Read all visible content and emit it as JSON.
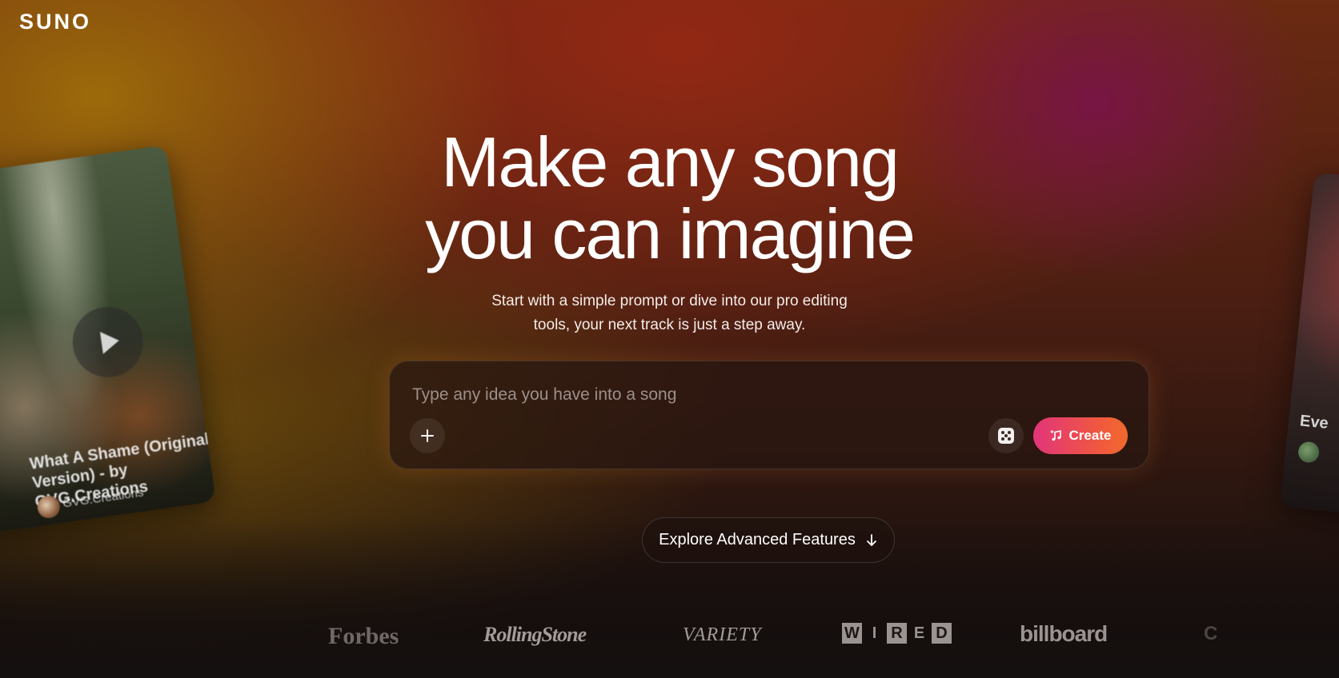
{
  "brand": {
    "logo": "SUNO"
  },
  "hero": {
    "title_line1": "Make any song",
    "title_line2": "you can imagine",
    "subtitle_line1": "Start with a simple prompt or dive into our pro editing",
    "subtitle_line2": "tools, your next track is just a step away."
  },
  "prompt": {
    "placeholder": "Type any idea you have into a song",
    "value": "",
    "create_label": "Create"
  },
  "explore": {
    "label": "Explore Advanced Features"
  },
  "cards": {
    "left": {
      "title": "What A Shame (Original Version) - by GVG.Creations",
      "author": "GVG.Creations"
    },
    "right": {
      "title": "Eve"
    }
  },
  "press": {
    "forbes": "Forbes",
    "rolling_stone": "RollingStone",
    "variety": "VARIETY",
    "wired": [
      "W",
      "I",
      "R",
      "E",
      "D"
    ],
    "billboard": "billboard"
  },
  "colors": {
    "create_gradient_start": "#e2357a",
    "create_gradient_end": "#f06a2c",
    "accent_magenta": "#78144a",
    "accent_gold": "#a06e0a"
  },
  "icons": {
    "plus": "plus-icon",
    "dice": "dice-icon",
    "music_note": "music-note-icon",
    "arrow_down": "arrow-down-icon",
    "play": "play-icon"
  }
}
